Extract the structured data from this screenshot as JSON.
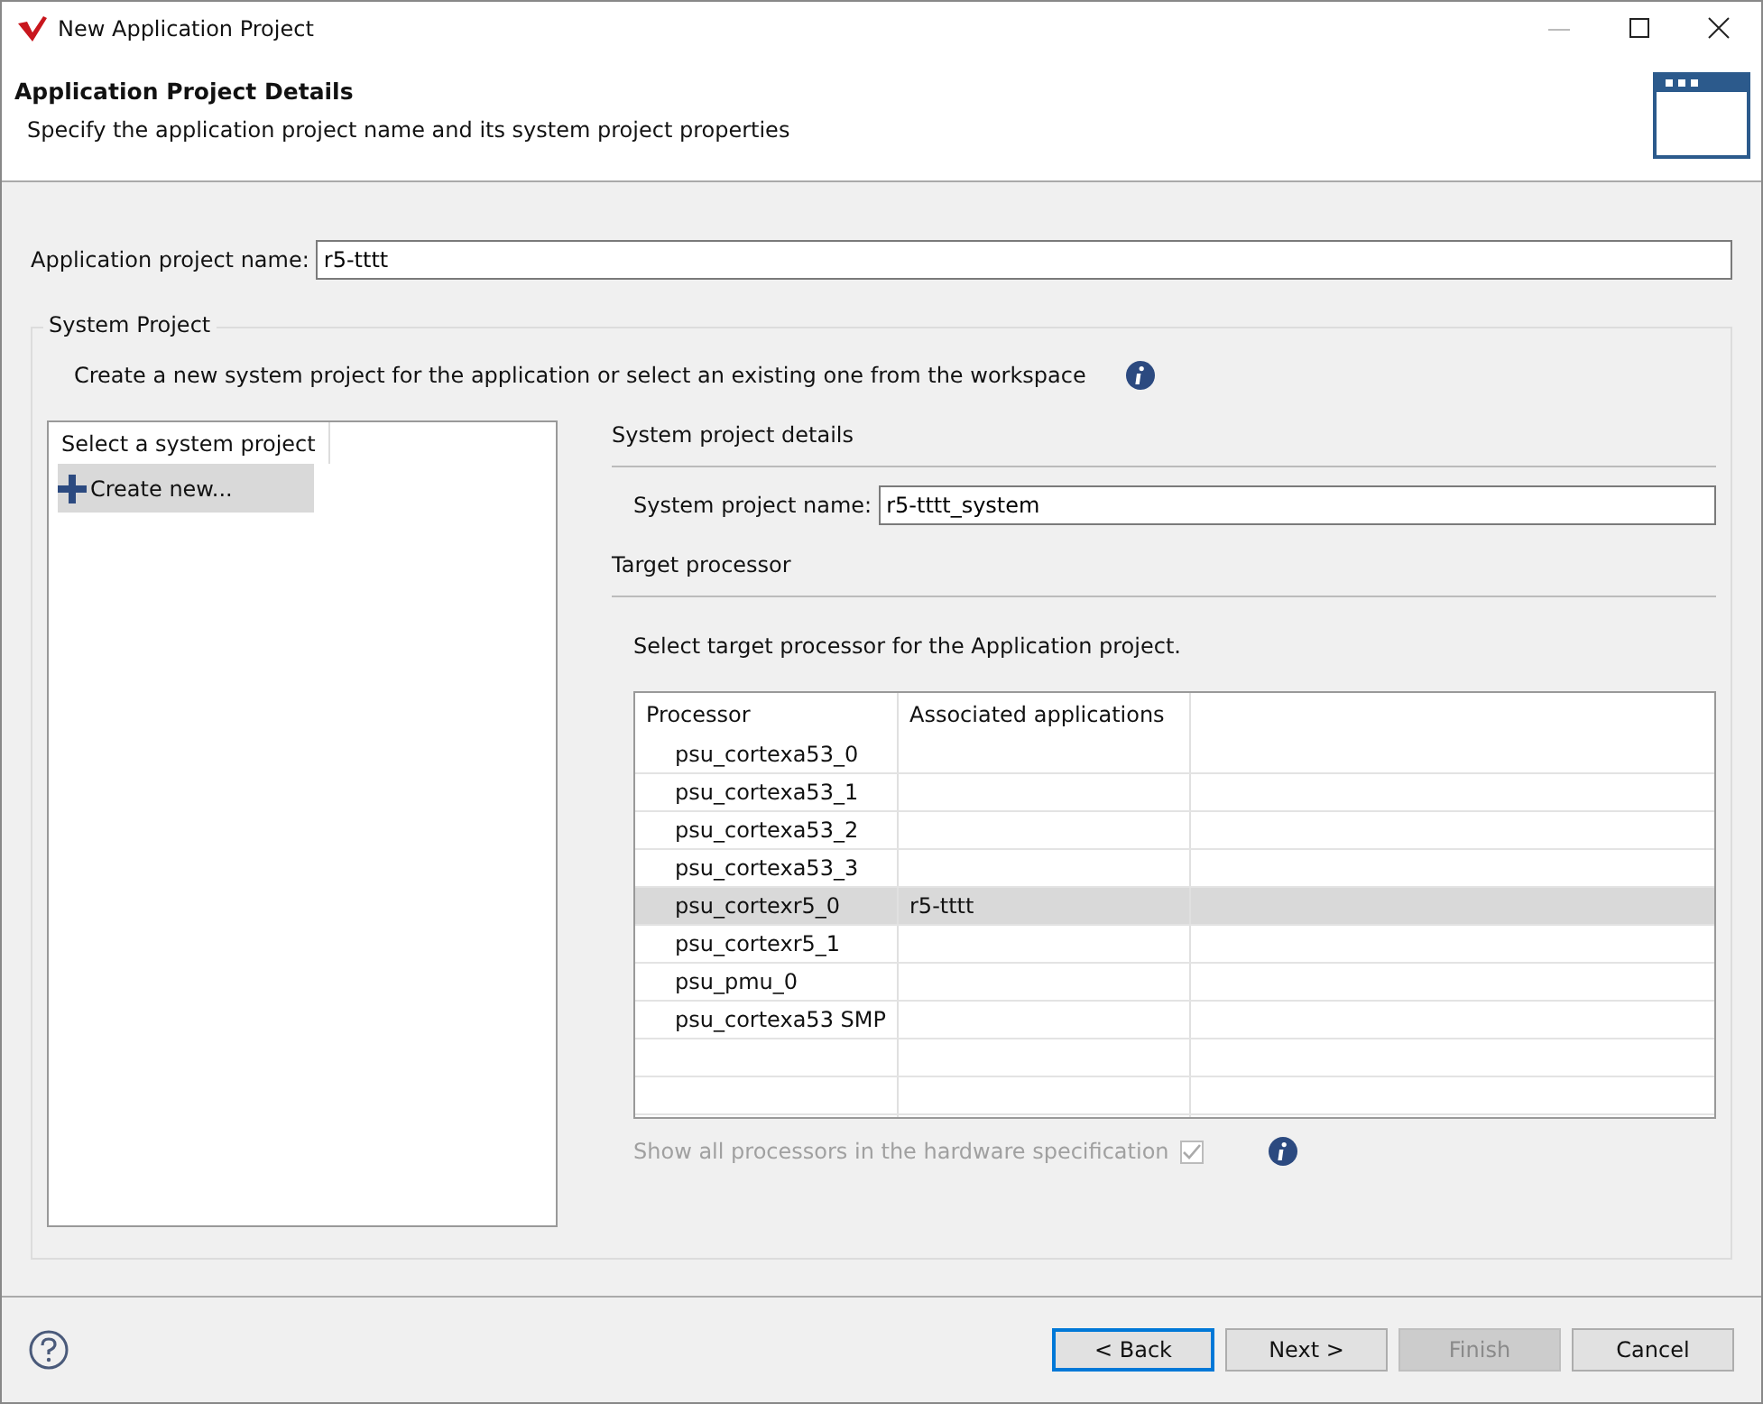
{
  "window": {
    "title": "New Application Project"
  },
  "header": {
    "title": "Application Project Details",
    "subtitle": "Specify the application project name and its system project properties"
  },
  "app_name": {
    "label": "Application project name:",
    "value": "r5-tttt"
  },
  "system_project": {
    "legend": "System Project",
    "description": "Create a new system project for the application or select an existing one from the workspace",
    "list": {
      "heading": "Select a system project",
      "items": [
        {
          "label": "Create new...",
          "selected": true
        }
      ]
    },
    "details": {
      "heading": "System project details",
      "name_label": "System project name:",
      "name_value": "r5-tttt_system"
    },
    "target": {
      "heading": "Target processor",
      "instruction": "Select target processor for the Application project.",
      "columns": [
        "Processor",
        "Associated applications"
      ],
      "rows": [
        {
          "processor": "psu_cortexa53_0",
          "apps": "",
          "selected": false
        },
        {
          "processor": "psu_cortexa53_1",
          "apps": "",
          "selected": false
        },
        {
          "processor": "psu_cortexa53_2",
          "apps": "",
          "selected": false
        },
        {
          "processor": "psu_cortexa53_3",
          "apps": "",
          "selected": false
        },
        {
          "processor": "psu_cortexr5_0",
          "apps": "r5-tttt",
          "selected": true
        },
        {
          "processor": "psu_cortexr5_1",
          "apps": "",
          "selected": false
        },
        {
          "processor": "psu_pmu_0",
          "apps": "",
          "selected": false
        },
        {
          "processor": "psu_cortexa53 SMP",
          "apps": "",
          "selected": false
        }
      ],
      "show_all": {
        "label": "Show all processors in the hardware specification",
        "checked": true,
        "disabled": true
      }
    }
  },
  "buttons": [
    {
      "label": "< Back",
      "disabled": false,
      "focused": true
    },
    {
      "label": "Next >",
      "disabled": false,
      "focused": false
    },
    {
      "label": "Finish",
      "disabled": true,
      "focused": false
    },
    {
      "label": "Cancel",
      "disabled": false,
      "focused": false
    }
  ]
}
